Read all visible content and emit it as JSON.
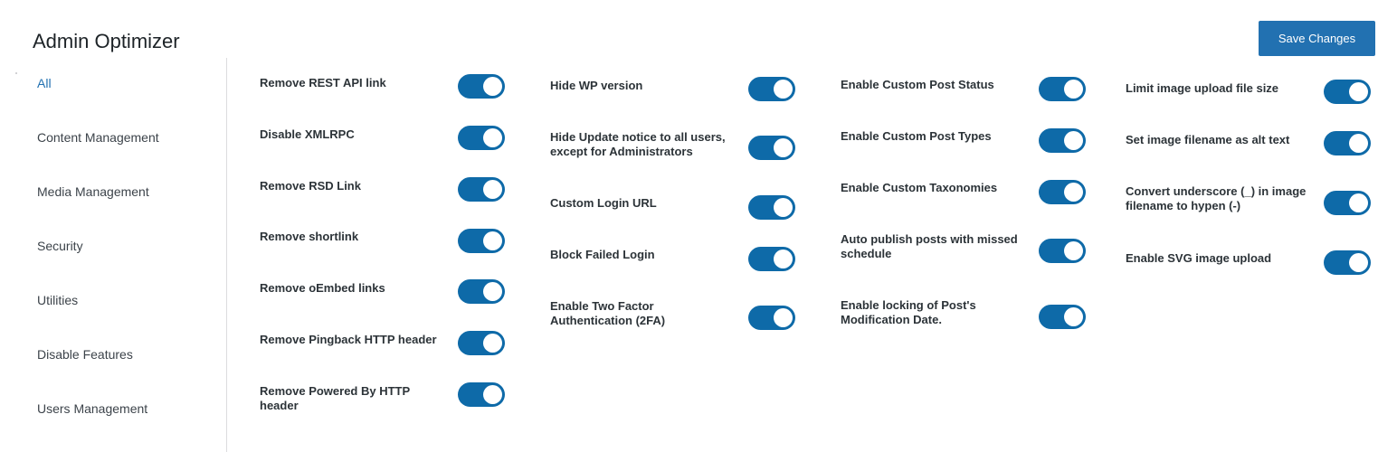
{
  "header": {
    "title": "Admin Optimizer",
    "save_label": "Save Changes"
  },
  "sidebar": {
    "items": [
      {
        "label": "All",
        "active": true
      },
      {
        "label": "Content Management",
        "active": false
      },
      {
        "label": "Media Management",
        "active": false
      },
      {
        "label": "Security",
        "active": false
      },
      {
        "label": "Utilities",
        "active": false
      },
      {
        "label": "Disable Features",
        "active": false
      },
      {
        "label": "Users Management",
        "active": false
      }
    ]
  },
  "colors": {
    "accent": "#2271b1",
    "toggle_on": "#0e6aa8"
  },
  "columns": [
    {
      "settings": [
        {
          "label": "Remove REST API link",
          "enabled": true
        },
        {
          "label": "Disable XMLRPC",
          "enabled": true
        },
        {
          "label": "Remove RSD Link",
          "enabled": true
        },
        {
          "label": "Remove shortlink",
          "enabled": true
        },
        {
          "label": "Remove oEmbed links",
          "enabled": true
        },
        {
          "label": "Remove Pingback HTTP header",
          "enabled": true
        },
        {
          "label": "Remove Powered By HTTP header",
          "enabled": true
        }
      ]
    },
    {
      "settings": [
        {
          "label": "Hide WP version",
          "enabled": true
        },
        {
          "label": "Hide Update notice to all users, except for Administrators",
          "enabled": true
        },
        {
          "label": "Custom Login URL",
          "enabled": true
        },
        {
          "label": "Block Failed Login",
          "enabled": true
        },
        {
          "label": "Enable Two Factor Authentication (2FA)",
          "enabled": true
        }
      ]
    },
    {
      "settings": [
        {
          "label": "Enable Custom Post Status",
          "enabled": true
        },
        {
          "label": "Enable Custom Post Types",
          "enabled": true
        },
        {
          "label": "Enable Custom Taxonomies",
          "enabled": true
        },
        {
          "label": "Auto publish posts with missed schedule",
          "enabled": true
        },
        {
          "label": "Enable locking of Post's Modification Date.",
          "enabled": true
        }
      ]
    },
    {
      "settings": [
        {
          "label": "Limit image upload file size",
          "enabled": true
        },
        {
          "label": "Set image filename as alt text",
          "enabled": true
        },
        {
          "label": "Convert underscore (_) in image filename to hypen (-)",
          "enabled": true
        },
        {
          "label": "Enable SVG image upload",
          "enabled": true
        }
      ]
    }
  ]
}
